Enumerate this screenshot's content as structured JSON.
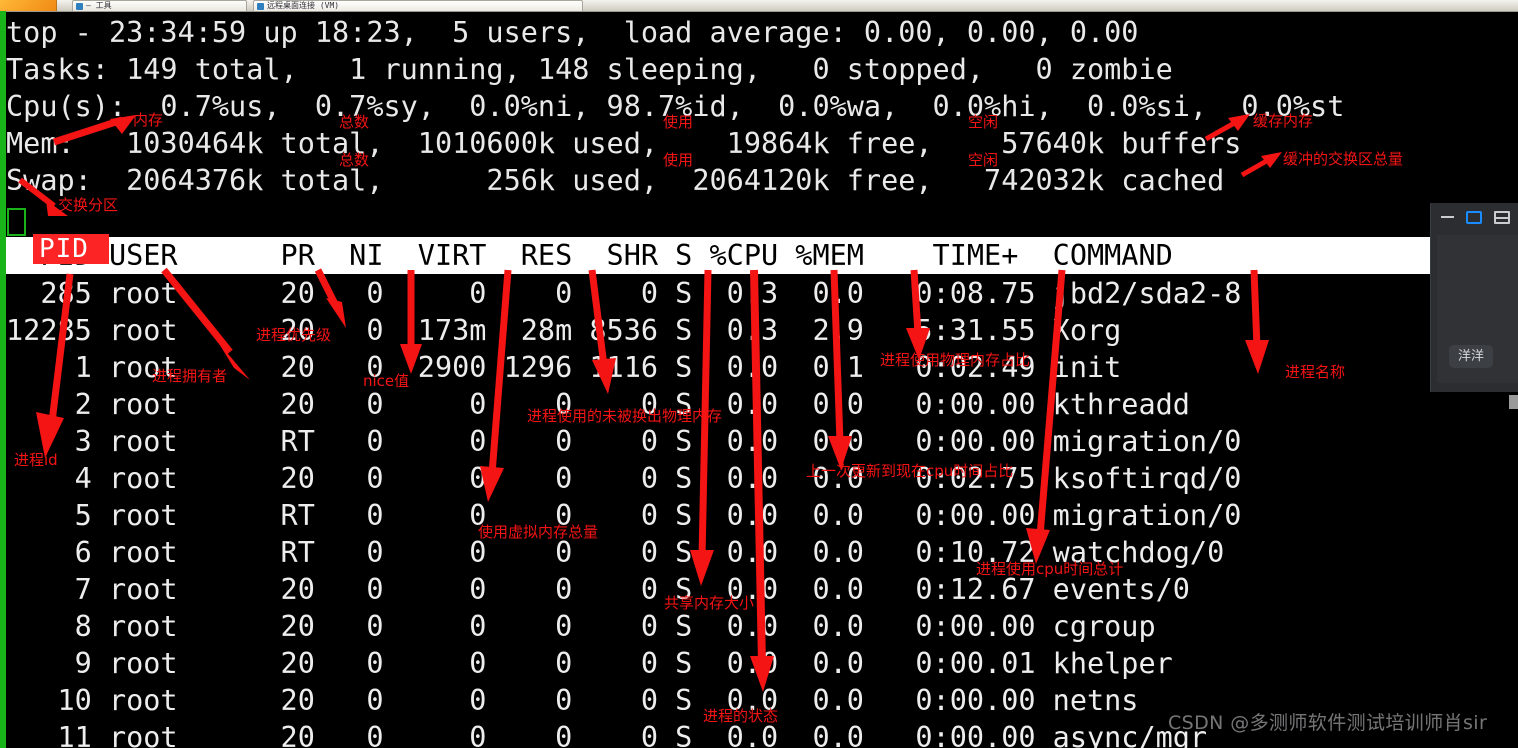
{
  "window": {
    "taskbar_tab_1": "— 工具",
    "taskbar_tab_2": "远程桌面连接 (VM)"
  },
  "terminal": {
    "summary": {
      "line_uptime": "top - 23:34:59 up 18:23,  5 users,  load average: 0.00, 0.00, 0.00",
      "line_tasks": "Tasks: 149 total,   1 running, 148 sleeping,   0 stopped,   0 zombie",
      "line_cpu": "Cpu(s):  0.7%us,  0.7%sy,  0.0%ni, 98.7%id,  0.0%wa,  0.0%hi,  0.0%si,  0.0%st",
      "line_mem": "Mem:   1030464k total,  1010600k used,    19864k free,    57640k buffers",
      "line_swap": "Swap:  2064376k total,      256k used,  2064120k free,   742032k cached"
    },
    "summary_fields": {
      "time": "23:34:59",
      "uptime": "18:23",
      "users": "5",
      "load_average": [
        "0.00",
        "0.00",
        "0.00"
      ],
      "tasks_total": "149",
      "tasks_running": "1",
      "tasks_sleeping": "148",
      "tasks_stopped": "0",
      "tasks_zombie": "0",
      "cpu_us": "0.7",
      "cpu_sy": "0.7",
      "cpu_ni": "0.0",
      "cpu_id": "98.7",
      "cpu_wa": "0.0",
      "cpu_hi": "0.0",
      "cpu_si": "0.0",
      "cpu_st": "0.0",
      "mem_total": "1030464k",
      "mem_used": "1010600k",
      "mem_free": "19864k",
      "mem_buffers": "57640k",
      "swap_total": "2064376k",
      "swap_used": "256k",
      "swap_free": "2064120k",
      "swap_cached": "742032k"
    },
    "column_header": "  PID USER      PR  NI  VIRT  RES  SHR S %CPU %MEM    TIME+  COMMAND",
    "column_header_labels": [
      "PID",
      "USER",
      "PR",
      "NI",
      "VIRT",
      "RES",
      "SHR",
      "S",
      "%CPU",
      "%MEM",
      "TIME+",
      "COMMAND"
    ],
    "pid_highlight_label": "PID",
    "rows": [
      "  285 root      20   0     0    0    0 S  0.3  0.0   0:08.75 jbd2/sda2-8",
      "12285 root      20   0  173m  28m 8536 S  0.3  2.9   5:31.55 Xorg",
      "    1 root      20   0  2900 1296 1116 S  0.0  0.1   0:02.49 init",
      "    2 root      20   0     0    0    0 S  0.0  0.0   0:00.00 kthreadd",
      "    3 root      RT   0     0    0    0 S  0.0  0.0   0:00.00 migration/0",
      "    4 root      20   0     0    0    0 S  0.0  0.0   0:02.75 ksoftirqd/0",
      "    5 root      RT   0     0    0    0 S  0.0  0.0   0:00.00 migration/0",
      "    6 root      RT   0     0    0    0 S  0.0  0.0   0:10.72 watchdog/0",
      "    7 root      20   0     0    0    0 S  0.0  0.0   0:12.67 events/0",
      "    8 root      20   0     0    0    0 S  0.0  0.0   0:00.00 cgroup",
      "    9 root      20   0     0    0    0 S  0.0  0.0   0:00.01 khelper",
      "   10 root      20   0     0    0    0 S  0.0  0.0   0:00.00 netns",
      "   11 root      20   0     0    0    0 S  0.0  0.0   0:00.00 async/mgr"
    ],
    "rows_structured": [
      {
        "pid": "285",
        "user": "root",
        "pr": "20",
        "ni": "0",
        "virt": "0",
        "res": "0",
        "shr": "0",
        "s": "S",
        "cpu": "0.3",
        "mem": "0.0",
        "time": "0:08.75",
        "command": "jbd2/sda2-8"
      },
      {
        "pid": "12285",
        "user": "root",
        "pr": "20",
        "ni": "0",
        "virt": "173m",
        "res": "28m",
        "shr": "8536",
        "s": "S",
        "cpu": "0.3",
        "mem": "2.9",
        "time": "5:31.55",
        "command": "Xorg"
      },
      {
        "pid": "1",
        "user": "root",
        "pr": "20",
        "ni": "0",
        "virt": "2900",
        "res": "1296",
        "shr": "1116",
        "s": "S",
        "cpu": "0.0",
        "mem": "0.1",
        "time": "0:02.49",
        "command": "init"
      },
      {
        "pid": "2",
        "user": "root",
        "pr": "20",
        "ni": "0",
        "virt": "0",
        "res": "0",
        "shr": "0",
        "s": "S",
        "cpu": "0.0",
        "mem": "0.0",
        "time": "0:00.00",
        "command": "kthreadd"
      },
      {
        "pid": "3",
        "user": "root",
        "pr": "RT",
        "ni": "0",
        "virt": "0",
        "res": "0",
        "shr": "0",
        "s": "S",
        "cpu": "0.0",
        "mem": "0.0",
        "time": "0:00.00",
        "command": "migration/0"
      },
      {
        "pid": "4",
        "user": "root",
        "pr": "20",
        "ni": "0",
        "virt": "0",
        "res": "0",
        "shr": "0",
        "s": "S",
        "cpu": "0.0",
        "mem": "0.0",
        "time": "0:02.75",
        "command": "ksoftirqd/0"
      },
      {
        "pid": "5",
        "user": "root",
        "pr": "RT",
        "ni": "0",
        "virt": "0",
        "res": "0",
        "shr": "0",
        "s": "S",
        "cpu": "0.0",
        "mem": "0.0",
        "time": "0:00.00",
        "command": "migration/0"
      },
      {
        "pid": "6",
        "user": "root",
        "pr": "RT",
        "ni": "0",
        "virt": "0",
        "res": "0",
        "shr": "0",
        "s": "S",
        "cpu": "0.0",
        "mem": "0.0",
        "time": "0:10.72",
        "command": "watchdog/0"
      },
      {
        "pid": "7",
        "user": "root",
        "pr": "20",
        "ni": "0",
        "virt": "0",
        "res": "0",
        "shr": "0",
        "s": "S",
        "cpu": "0.0",
        "mem": "0.0",
        "time": "0:12.67",
        "command": "events/0"
      },
      {
        "pid": "8",
        "user": "root",
        "pr": "20",
        "ni": "0",
        "virt": "0",
        "res": "0",
        "shr": "0",
        "s": "S",
        "cpu": "0.0",
        "mem": "0.0",
        "time": "0:00.00",
        "command": "cgroup"
      },
      {
        "pid": "9",
        "user": "root",
        "pr": "20",
        "ni": "0",
        "virt": "0",
        "res": "0",
        "shr": "0",
        "s": "S",
        "cpu": "0.0",
        "mem": "0.0",
        "time": "0:00.01",
        "command": "khelper"
      },
      {
        "pid": "10",
        "user": "root",
        "pr": "20",
        "ni": "0",
        "virt": "0",
        "res": "0",
        "shr": "0",
        "s": "S",
        "cpu": "0.0",
        "mem": "0.0",
        "time": "0:00.00",
        "command": "netns"
      },
      {
        "pid": "11",
        "user": "root",
        "pr": "20",
        "ni": "0",
        "virt": "0",
        "res": "0",
        "shr": "0",
        "s": "S",
        "cpu": "0.0",
        "mem": "0.0",
        "time": "0:00.00",
        "command": "async/mgr"
      }
    ]
  },
  "annotations": {
    "color": "#f41414",
    "labels": {
      "mem": "内存",
      "total_1": "总数",
      "used_1": "使用",
      "free_1": "空闲",
      "buffers": "缓存内存",
      "total_2": "总数",
      "used_2": "使用",
      "free_2": "空闲",
      "cached": "缓冲的交换区总量",
      "swap_partition": "交换分区",
      "pid": "进程id",
      "user": "进程拥有者",
      "pr": "进程优先级",
      "ni": "nice值",
      "virt": "使用虚拟内存总量",
      "res": "进程使用的未被换出物理内存",
      "shr": "共享内存大小",
      "s": "进程的状态",
      "cpu": "上一次更新到现在cpu时间占比",
      "mem_pct": "进程使用物理内存占比",
      "time": "进程使用cpu时间总计",
      "command": "进程名称"
    }
  },
  "side_panel": {
    "chip_label": "洋洋",
    "minimize": "minimize",
    "maximize": "maximize",
    "restore": "restore"
  },
  "watermark": "CSDN @多测师软件测试培训师肖sir"
}
